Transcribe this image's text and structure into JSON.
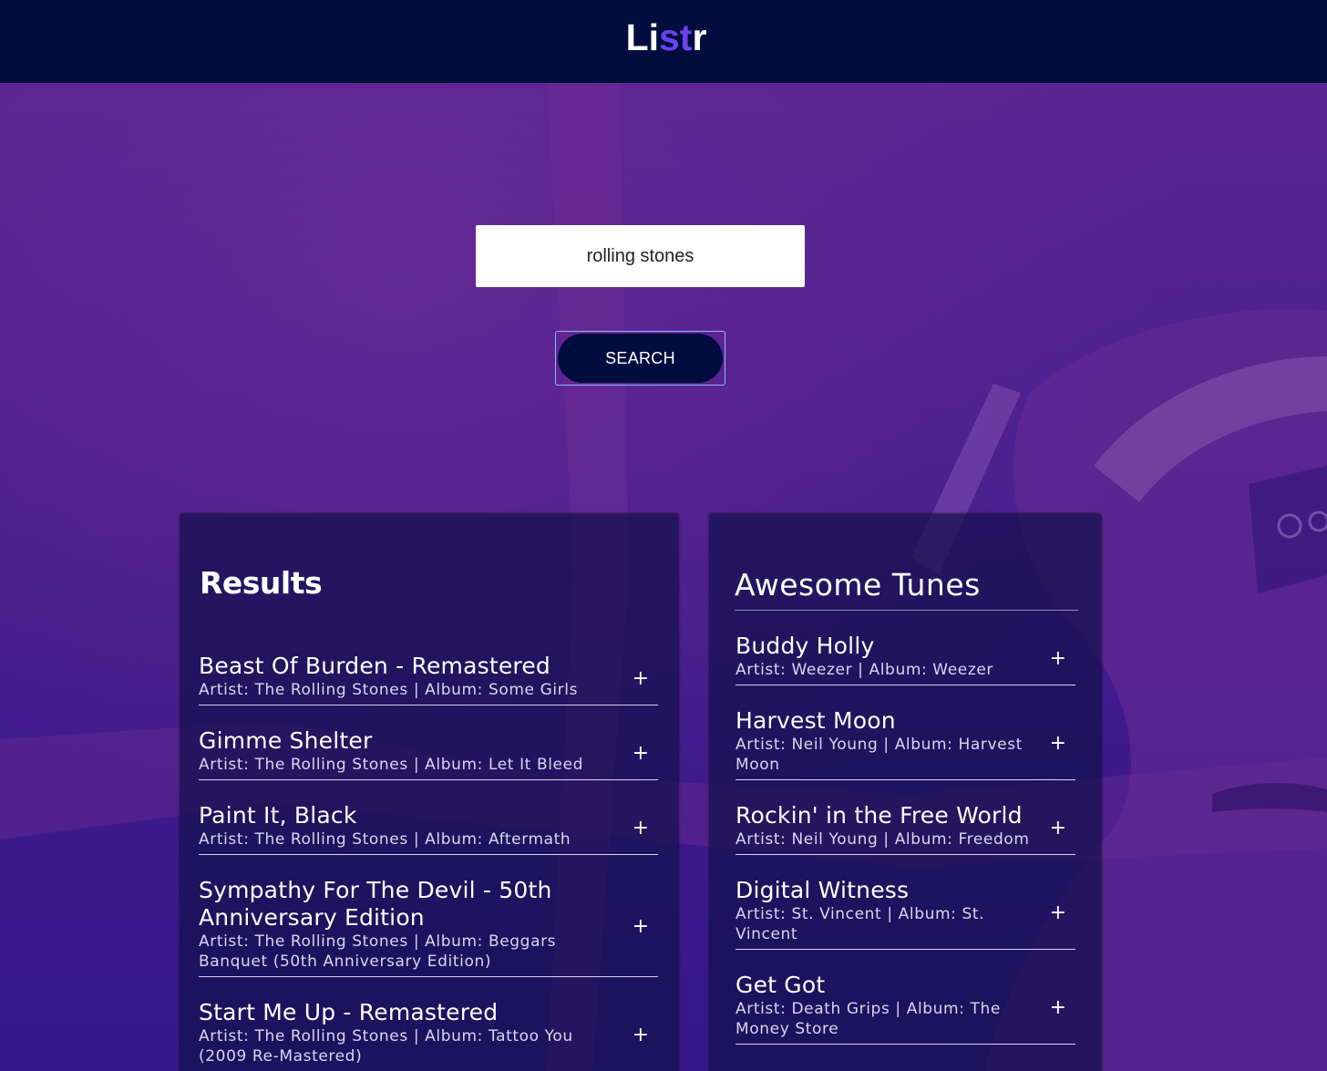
{
  "header": {
    "logo_prefix": "Li",
    "logo_accent": "st",
    "logo_suffix": "r"
  },
  "search": {
    "value": "rolling stones",
    "button_label": "SEARCH"
  },
  "results": {
    "title": "Results",
    "tracks": [
      {
        "name": "Beast Of Burden - Remastered",
        "meta": "Artist: The Rolling Stones | Album: Some Girls",
        "add": "+"
      },
      {
        "name": "Gimme Shelter",
        "meta": "Artist: The Rolling Stones | Album: Let It Bleed",
        "add": "+"
      },
      {
        "name": "Paint It, Black",
        "meta": "Artist: The Rolling Stones | Album: Aftermath",
        "add": "+"
      },
      {
        "name": "Sympathy For The Devil - 50th Anniversary Edition",
        "meta": "Artist: The Rolling Stones | Album: Beggars Banquet (50th Anniversary Edition)",
        "add": "+"
      },
      {
        "name": "Start Me Up - Remastered",
        "meta": "Artist: The Rolling Stones | Album: Tattoo You (2009 Re-Mastered)",
        "add": "+"
      }
    ]
  },
  "playlist": {
    "title": "Awesome Tunes",
    "tracks": [
      {
        "name": "Buddy Holly",
        "meta": "Artist: Weezer | Album: Weezer",
        "add": "+"
      },
      {
        "name": "Harvest Moon",
        "meta": "Artist: Neil Young | Album: Harvest Moon",
        "add": "+"
      },
      {
        "name": "Rockin' in the Free World",
        "meta": "Artist: Neil Young | Album: Freedom",
        "add": "+"
      },
      {
        "name": "Digital Witness",
        "meta": "Artist: St. Vincent | Album: St. Vincent",
        "add": "+"
      },
      {
        "name": "Get Got",
        "meta": "Artist: Death Grips | Album: The Money Store",
        "add": "+"
      }
    ]
  },
  "colors": {
    "header_bg": "#010c3f",
    "logo_accent": "#6c41ec",
    "background_purple": "#4a1f8f"
  }
}
